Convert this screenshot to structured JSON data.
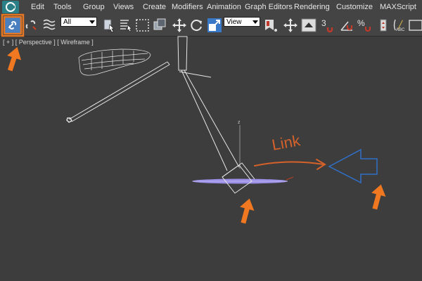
{
  "menubar": {
    "items": [
      {
        "label": "Edit"
      },
      {
        "label": "Tools"
      },
      {
        "label": "Group"
      },
      {
        "label": "Views"
      },
      {
        "label": "Create"
      },
      {
        "label": "Modifiers"
      },
      {
        "label": "Animation"
      },
      {
        "label": "Graph Editors"
      },
      {
        "label": "Rendering"
      },
      {
        "label": "Customize"
      },
      {
        "label": "MAXScript"
      }
    ]
  },
  "toolbar": {
    "selection_filter": "All",
    "reference_coord": "View",
    "snaps_label": "3",
    "percent_snap_label": "%",
    "abc_label": "ABC",
    "icons": [
      "select-and-link-icon",
      "unlink-selection-icon",
      "bind-to-space-warp-icon",
      "select-object-icon",
      "select-by-name-icon",
      "rectangular-selection-icon",
      "window-crossing-icon",
      "select-and-move-icon",
      "select-and-rotate-icon",
      "select-and-scale-icon",
      "use-pivot-center-icon",
      "select-and-manipulate-icon",
      "snaps-toggle-icon",
      "angle-snap-icon",
      "percent-snap-icon",
      "spinner-snap-icon",
      "edit-named-selection-icon"
    ]
  },
  "viewport": {
    "label": "[ + ] [ Perspective ] [ Wireframe ]",
    "axis_label": "z"
  },
  "annotations": {
    "link_text": "Link",
    "colors": {
      "highlight": "#e87722",
      "arrow": "#f07820",
      "link_text": "#d4622a",
      "bone_selected": "#9b8fe8",
      "target_arrow": "#3070c8",
      "wireframe": "#e6e6e6"
    }
  }
}
